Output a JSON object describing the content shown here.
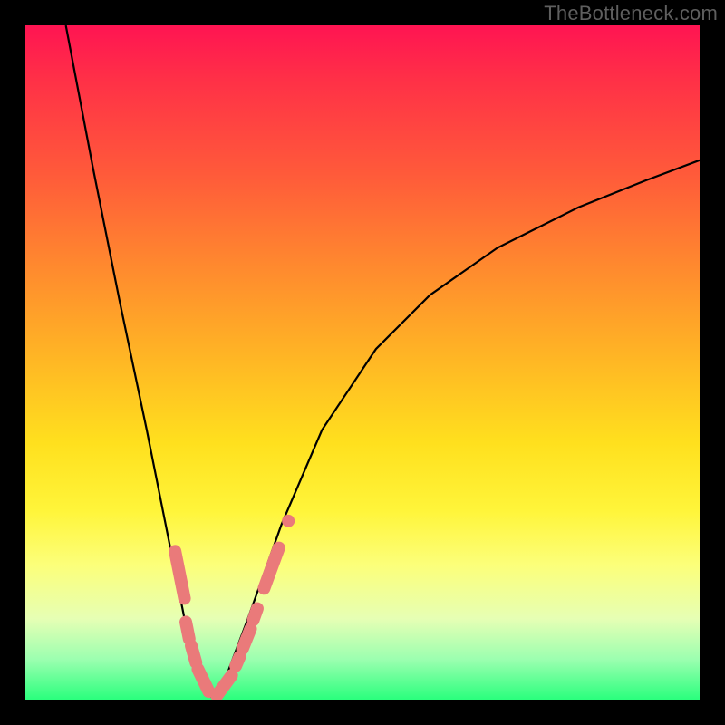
{
  "watermark": "TheBottleneck.com",
  "chart_data": {
    "type": "line",
    "title": "",
    "xlabel": "",
    "ylabel": "",
    "xlim": [
      0,
      100
    ],
    "ylim": [
      0,
      100
    ],
    "grid": false,
    "legend": false,
    "series": [
      {
        "name": "left_curve",
        "x": [
          6,
          10,
          14,
          18,
          22,
          24,
          26,
          27,
          28
        ],
        "values": [
          100,
          79,
          59,
          40,
          20,
          10,
          4,
          1,
          0
        ]
      },
      {
        "name": "right_curve",
        "x": [
          28,
          30,
          33,
          38,
          44,
          52,
          60,
          70,
          82,
          92,
          100
        ],
        "values": [
          0,
          4,
          12,
          26,
          40,
          52,
          60,
          67,
          73,
          77,
          80
        ]
      }
    ],
    "highlights": {
      "name": "pink_markers",
      "description": "thick pink segments and dots on lower portions of both curves",
      "left_curve_segments": [
        {
          "x0": 22.2,
          "y0": 22,
          "x1": 23.6,
          "y1": 15
        },
        {
          "x0": 23.8,
          "y0": 11.5,
          "x1": 24.3,
          "y1": 9
        },
        {
          "x0": 24.6,
          "y0": 8,
          "x1": 25.3,
          "y1": 5.5
        },
        {
          "x0": 25.6,
          "y0": 4.5,
          "x1": 27.2,
          "y1": 1.2
        }
      ],
      "right_curve_segments": [
        {
          "x0": 28.4,
          "y0": 0.6,
          "x1": 30.6,
          "y1": 3.6
        },
        {
          "x0": 31.2,
          "y0": 5.0,
          "x1": 31.8,
          "y1": 6.4
        },
        {
          "x0": 32.2,
          "y0": 7.5,
          "x1": 33.4,
          "y1": 10.5
        },
        {
          "x0": 33.8,
          "y0": 11.8,
          "x1": 34.4,
          "y1": 13.5
        },
        {
          "x0": 35.4,
          "y0": 16.5,
          "x1": 37.6,
          "y1": 22.5
        }
      ],
      "dots": [
        {
          "x": 39.0,
          "y": 26.5
        }
      ]
    },
    "background_gradient": {
      "orientation": "vertical",
      "stops": [
        {
          "pos": 0.0,
          "color": "#ff1452"
        },
        {
          "pos": 0.36,
          "color": "#ff8a2e"
        },
        {
          "pos": 0.62,
          "color": "#ffe01e"
        },
        {
          "pos": 0.88,
          "color": "#e6ffb4"
        },
        {
          "pos": 1.0,
          "color": "#2aff7d"
        }
      ]
    }
  }
}
